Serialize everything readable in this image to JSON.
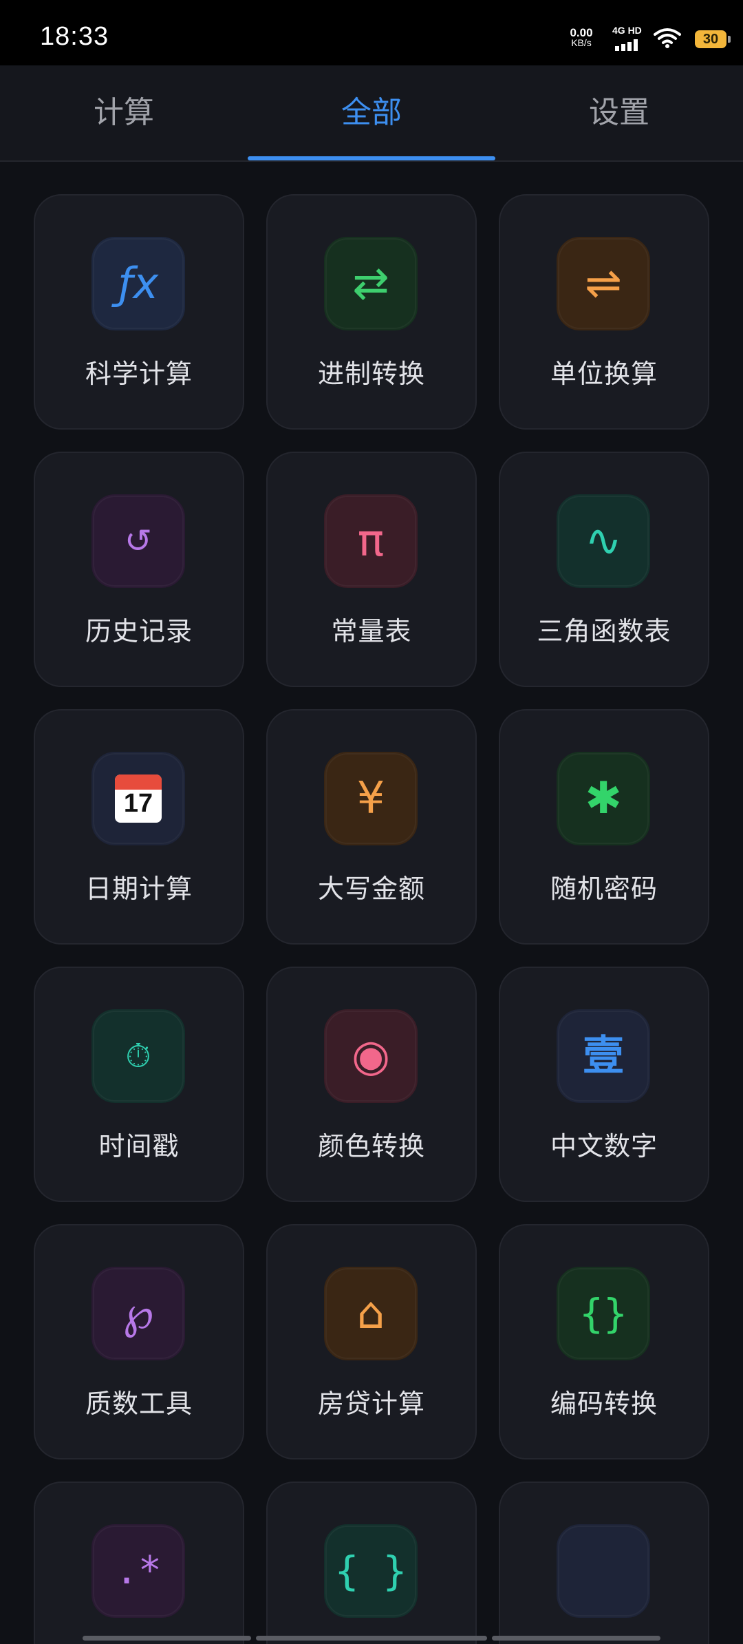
{
  "status_bar": {
    "time": "18:33",
    "net_speed_value": "0.00",
    "net_speed_unit": "KB/s",
    "signal_label": "4G HD",
    "battery": "30"
  },
  "tabs": [
    {
      "label": "计算"
    },
    {
      "label": "全部"
    },
    {
      "label": "设置"
    }
  ],
  "active_tab": "全部",
  "tools": [
    {
      "label": "科学计算",
      "icon": "function-icon",
      "glyph": "ƒx",
      "color": "#3d8ff0",
      "bg": "#1e2840"
    },
    {
      "label": "进制转换",
      "icon": "swap-arrows-icon",
      "glyph": "⇄",
      "color": "#3ecf6e",
      "bg": "#16301f"
    },
    {
      "label": "单位换算",
      "icon": "exchange-icon",
      "glyph": "⇌",
      "color": "#f5a049",
      "bg": "#3a2614"
    },
    {
      "label": "历史记录",
      "icon": "history-icon",
      "glyph": "↺",
      "color": "#b778e8",
      "bg": "#2a1a33"
    },
    {
      "label": "常量表",
      "icon": "pi-icon",
      "glyph": "π",
      "color": "#f2678b",
      "bg": "#3a1d27"
    },
    {
      "label": "三角函数表",
      "icon": "sine-wave-icon",
      "glyph": "∿",
      "color": "#2fd0b0",
      "bg": "#13302c"
    },
    {
      "label": "日期计算",
      "icon": "calendar-icon",
      "glyph": "17",
      "color": "#e74c3c",
      "bg": "#1e2438"
    },
    {
      "label": "大写金额",
      "icon": "yen-icon",
      "glyph": "¥",
      "color": "#f5a049",
      "bg": "#3a2614"
    },
    {
      "label": "随机密码",
      "icon": "asterisk-icon",
      "glyph": "✱",
      "color": "#33d46a",
      "bg": "#16301f"
    },
    {
      "label": "时间戳",
      "icon": "stopwatch-icon",
      "glyph": "⏱",
      "color": "#2fd0b0",
      "bg": "#13302c"
    },
    {
      "label": "颜色转换",
      "icon": "color-dot-icon",
      "glyph": "◉",
      "color": "#f2678b",
      "bg": "#3a1d27"
    },
    {
      "label": "中文数字",
      "icon": "chinese-numeral-icon",
      "glyph": "壹",
      "color": "#3d8ff0",
      "bg": "#1e2438"
    },
    {
      "label": "质数工具",
      "icon": "prime-icon",
      "glyph": "℘",
      "color": "#b778e8",
      "bg": "#2a1a33"
    },
    {
      "label": "房贷计算",
      "icon": "house-icon",
      "glyph": "⌂",
      "color": "#f5a049",
      "bg": "#3a2614"
    },
    {
      "label": "编码转换",
      "icon": "braces-icon",
      "glyph": "{}",
      "color": "#33d46a",
      "bg": "#16301f"
    },
    {
      "label": "",
      "icon": "regex-icon",
      "glyph": ".*",
      "color": "#b778e8",
      "bg": "#2a1a33"
    },
    {
      "label": "",
      "icon": "json-braces-icon",
      "glyph": "{ }",
      "color": "#2fd0b0",
      "bg": "#13302c"
    },
    {
      "label": "",
      "icon": "blank-icon",
      "glyph": "",
      "color": "#3d8ff0",
      "bg": "#1e2438"
    }
  ]
}
